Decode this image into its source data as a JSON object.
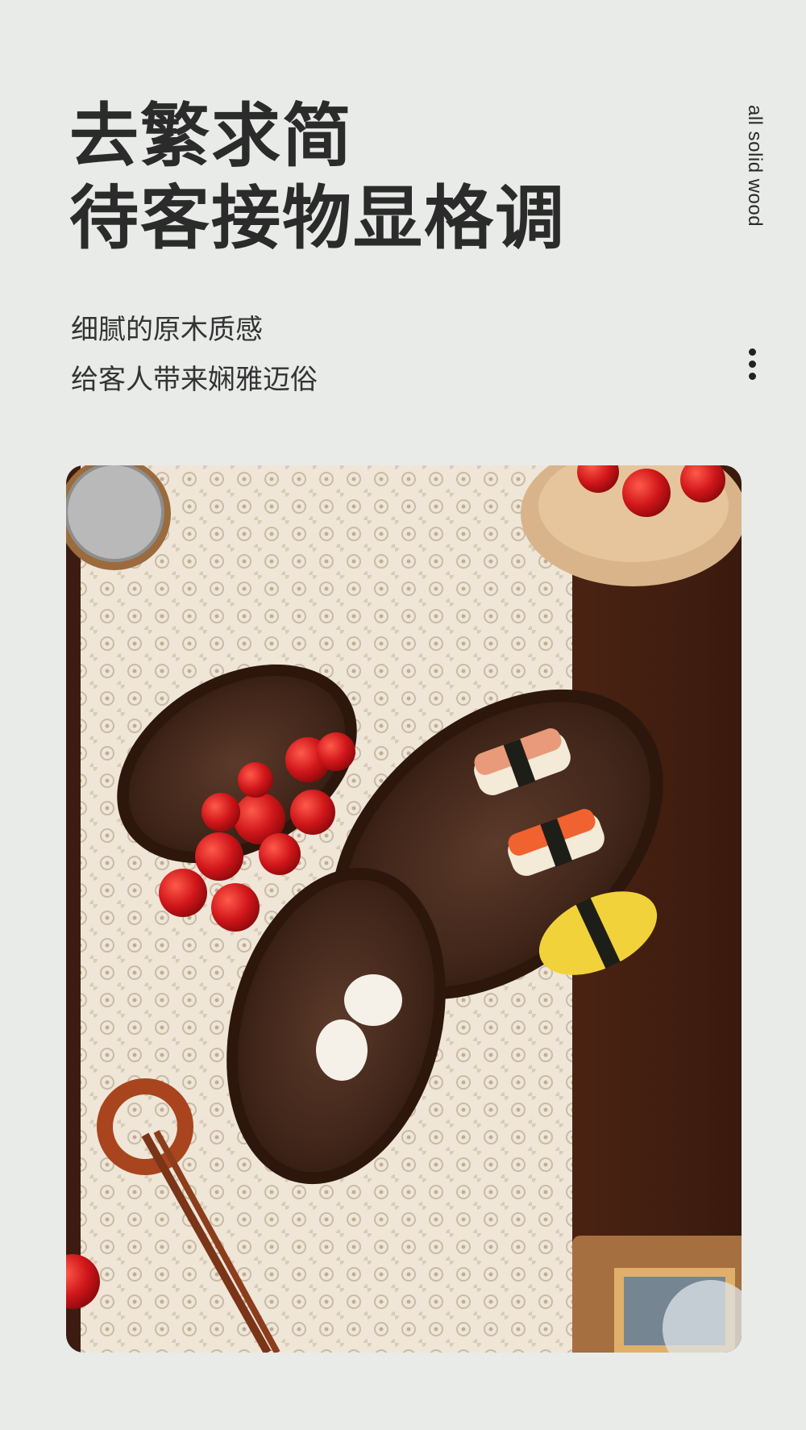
{
  "headline": {
    "line1": "去繁求简",
    "line2": "待客接物显格调"
  },
  "side_label": "all solid wood",
  "subtitle": {
    "line1": "细腻的原木质感",
    "line2": "给客人带来娴雅迈俗"
  },
  "icons": {
    "more": "more-vertical-icon"
  },
  "colors": {
    "background": "#e9ebe9",
    "text": "#2b2b2b",
    "walnut": "#4a2b1c",
    "lace": "#efe6d8",
    "tomato": "#c8141a"
  }
}
